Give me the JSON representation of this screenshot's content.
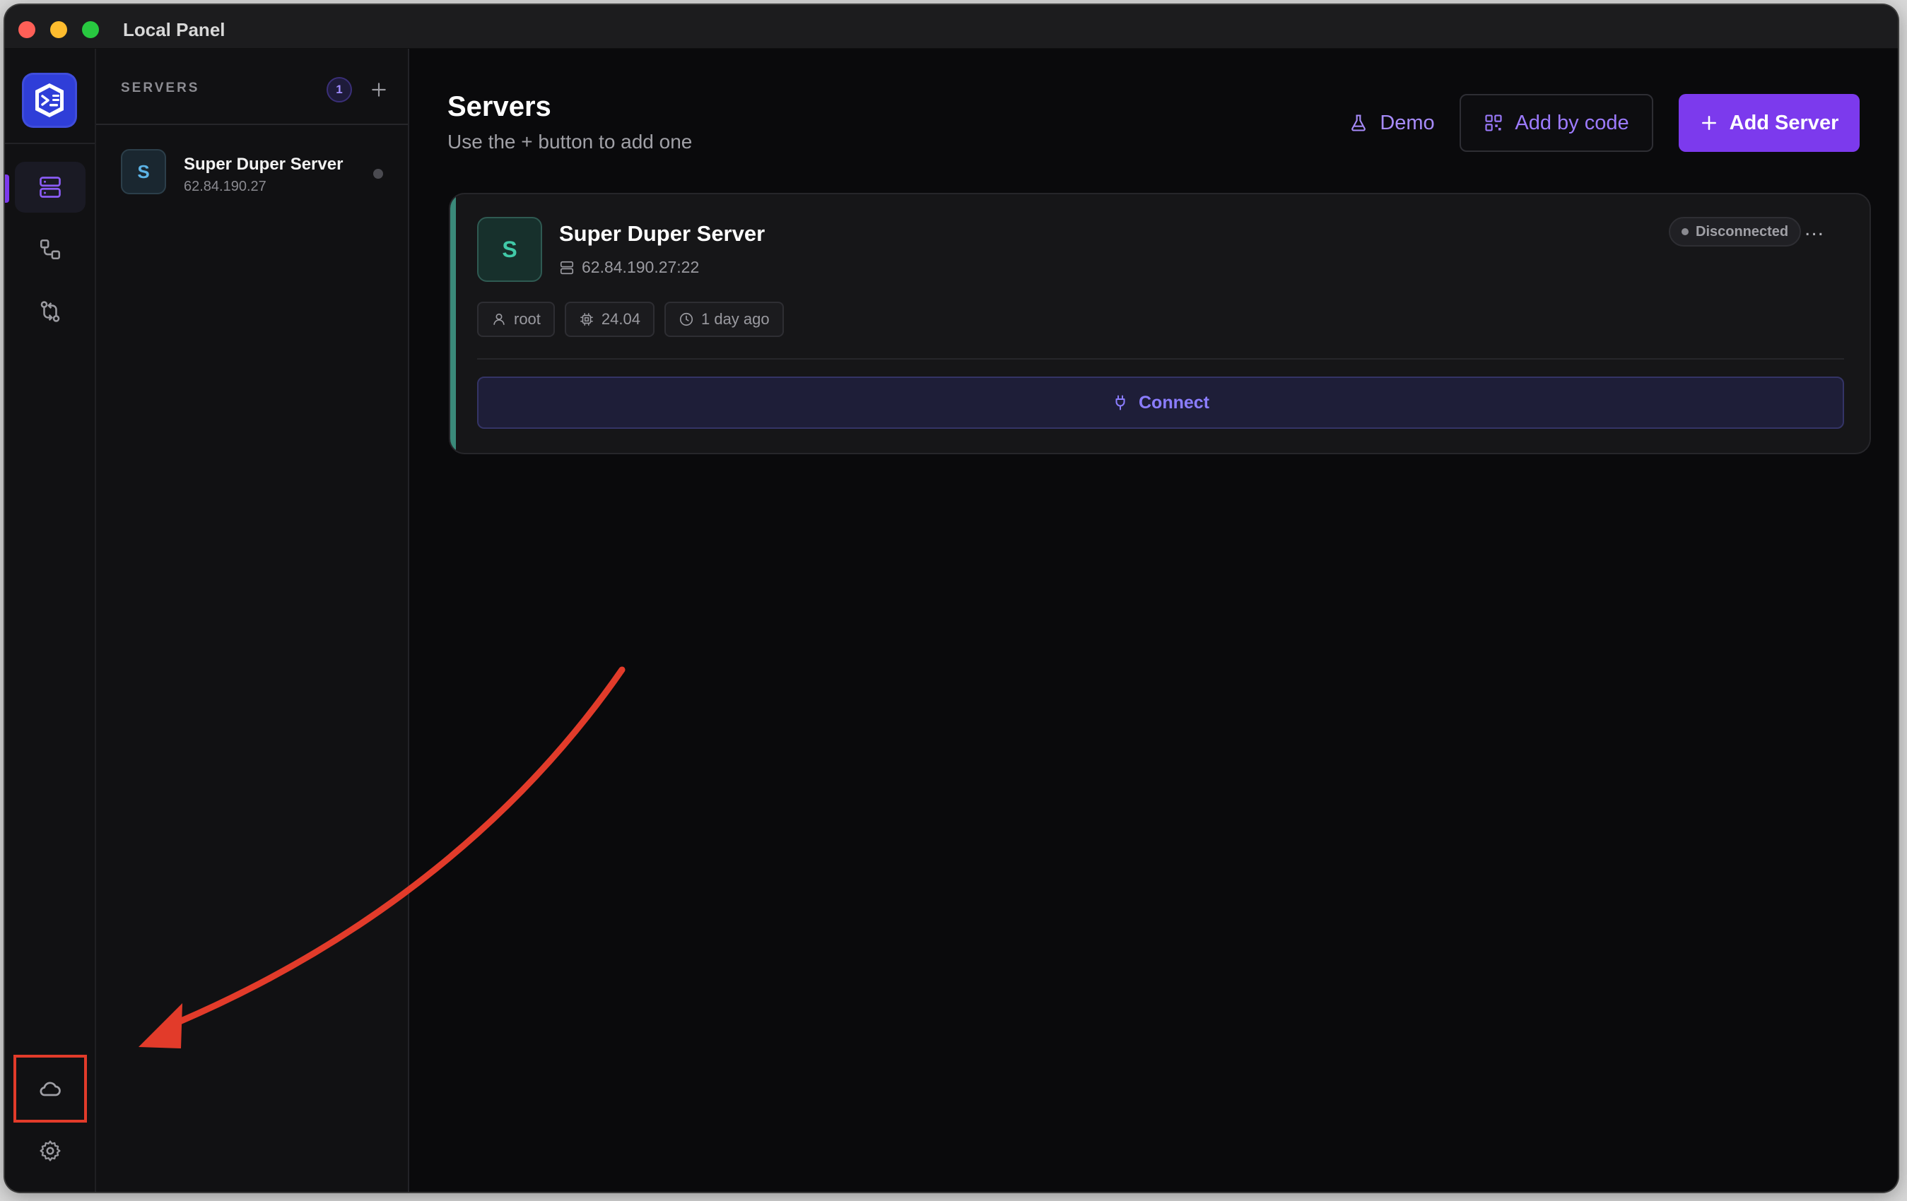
{
  "window": {
    "title": "Local Panel"
  },
  "rail": {
    "items": [
      {
        "name": "servers",
        "icon": "server-icon",
        "active": true
      },
      {
        "name": "connections",
        "icon": "nodes-icon",
        "active": false
      },
      {
        "name": "transfers",
        "icon": "git-compare-icon",
        "active": false
      }
    ],
    "bottom": [
      {
        "name": "cloud",
        "icon": "cloud-icon"
      },
      {
        "name": "settings",
        "icon": "gear-icon"
      }
    ]
  },
  "serverlist": {
    "title": "SERVERS",
    "count": "1",
    "items": [
      {
        "avatar": "S",
        "name": "Super Duper Server",
        "ip": "62.84.190.27"
      }
    ]
  },
  "main": {
    "title": "Servers",
    "subtitle": "Use the + button to add one",
    "demo_label": "Demo",
    "add_by_code_label": "Add by code",
    "add_server_label": "Add Server"
  },
  "card": {
    "avatar": "S",
    "name": "Super Duper Server",
    "address": "62.84.190.27:22",
    "status": "Disconnected",
    "more": "...",
    "user": "root",
    "os_version": "24.04",
    "last_seen": "1 day ago",
    "connect_label": "Connect"
  },
  "colors": {
    "accent": "#7c3aed",
    "annotation": "#e23b2a",
    "card_accent": "#3a8a7a"
  }
}
